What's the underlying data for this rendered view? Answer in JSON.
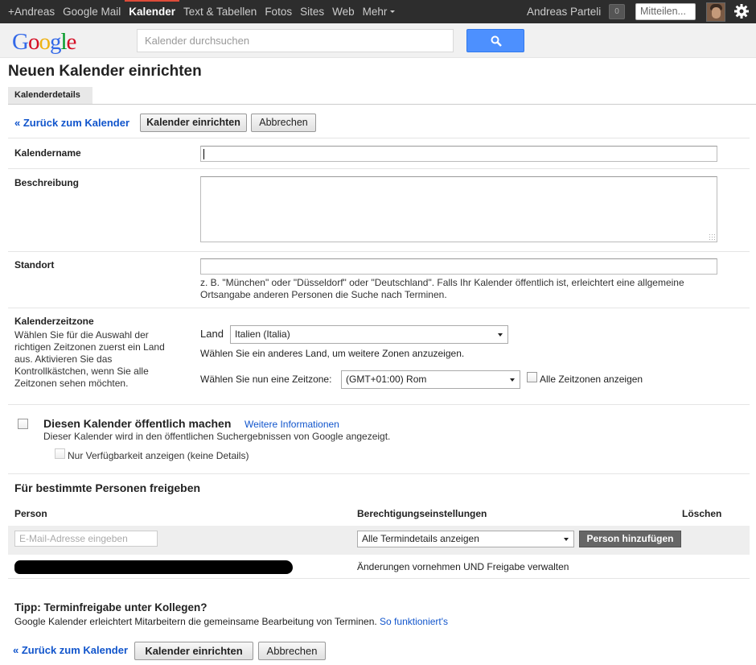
{
  "topnav": {
    "items": [
      {
        "label": "+Andreas",
        "active": false
      },
      {
        "label": "Google Mail",
        "active": false
      },
      {
        "label": "Kalender",
        "active": true
      },
      {
        "label": "Text & Tabellen",
        "active": false
      },
      {
        "label": "Fotos",
        "active": false
      },
      {
        "label": "Sites",
        "active": false
      },
      {
        "label": "Web",
        "active": false
      },
      {
        "label": "Mehr",
        "active": false
      }
    ],
    "user_name": "Andreas Parteli",
    "notification_count": "0",
    "share_placeholder": "Mitteilen..."
  },
  "header": {
    "logo": "Google",
    "search_placeholder": "Kalender durchsuchen"
  },
  "page": {
    "title": "Neuen Kalender einrichten",
    "tab": "Kalenderdetails"
  },
  "actions": {
    "back": "« Zurück zum Kalender",
    "create": "Kalender einrichten",
    "cancel": "Abbrechen"
  },
  "form": {
    "name_label": "Kalendername",
    "name_value": "",
    "description_label": "Beschreibung",
    "location_label": "Standort",
    "location_help": "z. B. \"München\" oder \"Düsseldorf\" oder \"Deutschland\". Falls Ihr Kalender öffentlich ist, erleichtert eine allgemeine Ortsangabe anderen Personen die Suche nach Terminen.",
    "timezone_label": "Kalenderzeitzone",
    "timezone_help": "Wählen Sie für die Auswahl der richtigen Zeitzonen zuerst ein Land aus. Aktivieren Sie das Kontrollkästchen, wenn Sie alle Zeitzonen sehen möchten.",
    "country_label": "Land",
    "country_value": "Italien (Italia)",
    "country_help": "Wählen Sie ein anderes Land, um weitere Zonen anzuzeigen.",
    "zone_label": "Wählen Sie nun eine Zeitzone:",
    "zone_value": "(GMT+01:00) Rom",
    "all_zones_label": "Alle Zeitzonen anzeigen"
  },
  "public": {
    "title": "Diesen Kalender öffentlich machen",
    "more_info": "Weitere Informationen",
    "description": "Dieser Kalender wird in den öffentlichen Suchergebnissen von Google angezeigt.",
    "free_busy_label": "Nur Verfügbarkeit anzeigen (keine Details)"
  },
  "sharing": {
    "title": "Für bestimmte Personen freigeben",
    "col_person": "Person",
    "col_permission": "Berechtigungseinstellungen",
    "col_delete": "Löschen",
    "email_placeholder": "E-Mail-Adresse eingeben",
    "permission_value": "Alle Termindetails anzeigen",
    "add_button": "Person hinzufügen",
    "row_permission": "Änderungen vornehmen UND Freigabe verwalten"
  },
  "tip": {
    "title": "Tipp: Terminfreigabe unter Kollegen?",
    "text": "Google Kalender erleichtert Mitarbeitern die gemeinsame Bearbeitung von Terminen.",
    "link": "So funktioniert's"
  }
}
